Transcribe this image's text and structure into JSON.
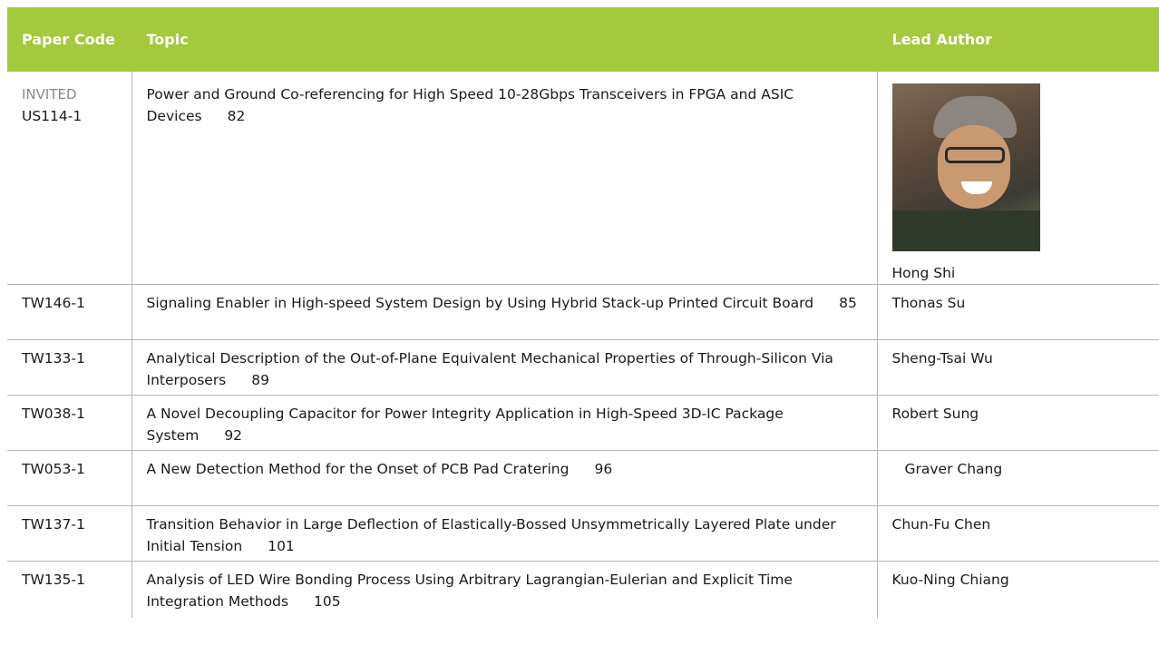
{
  "headers": {
    "code": "Paper Code",
    "topic": "Topic",
    "author": "Lead Author"
  },
  "rows": [
    {
      "badge": "INVITED",
      "code": "US114-1",
      "topic": "Power and Ground Co-referencing for High Speed 10-28Gbps Transceivers in FPGA and ASIC Devices",
      "page": "82",
      "author": "Hong Shi"
    },
    {
      "code": "TW146-1",
      "topic": "Signaling Enabler in High-speed System Design by Using Hybrid Stack-up Printed Circuit Board",
      "page": "85",
      "author": "Thonas Su"
    },
    {
      "code": "TW133-1",
      "topic": "Analytical Description of the Out-of-Plane Equivalent Mechanical Properties of Through-Silicon Via Interposers",
      "page": "89",
      "author": "Sheng-Tsai Wu"
    },
    {
      "code": "TW038-1",
      "topic": "A Novel Decoupling Capacitor for Power Integrity Application in High-Speed 3D-IC Package System",
      "page": "92",
      "author": "Robert Sung"
    },
    {
      "code": "TW053-1",
      "topic": "A New Detection Method for the Onset of PCB Pad Cratering",
      "page": "96",
      "author": "Graver Chang"
    },
    {
      "code": "TW137-1",
      "topic": "Transition Behavior in Large Deflection of Elastically-Bossed Unsymmetrically Layered Plate under Initial Tension",
      "page": "101",
      "author": "Chun-Fu Chen"
    },
    {
      "code": "TW135-1",
      "topic": "Analysis of LED Wire Bonding Process Using Arbitrary Lagrangian-Eulerian and Explicit Time Integration Methods",
      "page": "105",
      "author": "Kuo-Ning Chiang"
    }
  ]
}
